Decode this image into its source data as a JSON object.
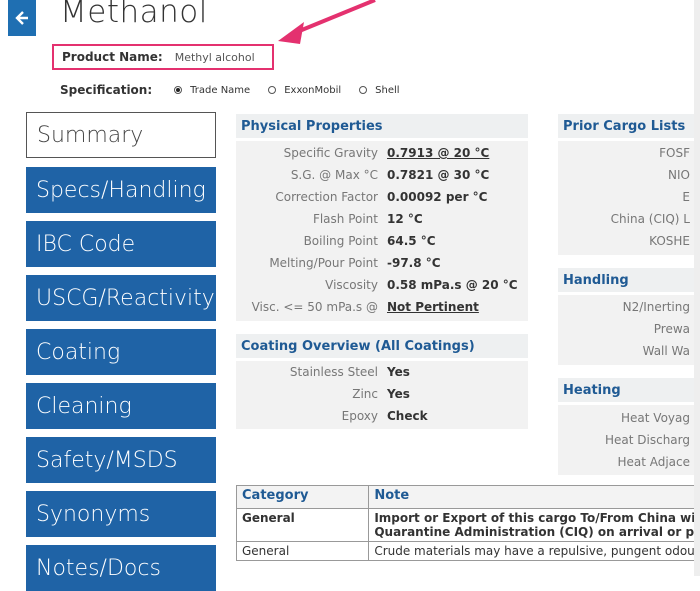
{
  "header": {
    "title": "Methanol"
  },
  "product": {
    "label": "Product Name:",
    "value": "Methyl alcohol"
  },
  "specification": {
    "label": "Specification:",
    "options": [
      {
        "label": "Trade Name",
        "selected": true
      },
      {
        "label": "ExxonMobil",
        "selected": false
      },
      {
        "label": "Shell",
        "selected": false
      }
    ]
  },
  "nav": [
    {
      "label": "Summary",
      "active": true
    },
    {
      "label": "Specs/Handling",
      "active": false
    },
    {
      "label": "IBC Code",
      "active": false
    },
    {
      "label": "USCG/Reactivity",
      "active": false
    },
    {
      "label": "Coating",
      "active": false
    },
    {
      "label": "Cleaning",
      "active": false
    },
    {
      "label": "Safety/MSDS",
      "active": false
    },
    {
      "label": "Synonyms",
      "active": false
    },
    {
      "label": "Notes/Docs",
      "active": false
    }
  ],
  "physical": {
    "title": "Physical Properties",
    "rows": [
      {
        "key": "Specific Gravity",
        "value": "0.7913 @ 20 °C",
        "link": true
      },
      {
        "key": "S.G. @ Max °C",
        "value": "0.7821 @ 30 °C",
        "link": false
      },
      {
        "key": "Correction Factor",
        "value": "0.00092 per °C",
        "link": false
      },
      {
        "key": "Flash Point",
        "value": "12 °C",
        "link": false
      },
      {
        "key": "Boiling Point",
        "value": "64.5 °C",
        "link": false
      },
      {
        "key": "Melting/Pour Point",
        "value": "-97.8 °C",
        "link": false
      },
      {
        "key": "Viscosity",
        "value": "0.58 mPa.s @ 20 °C",
        "link": false
      },
      {
        "key": "Visc. <= 50 mPa.s @",
        "value": "Not Pertinent",
        "link": true
      }
    ]
  },
  "coating": {
    "title": "Coating Overview (All Coatings)",
    "rows": [
      {
        "key": "Stainless Steel",
        "value": "Yes"
      },
      {
        "key": "Zinc",
        "value": "Yes"
      },
      {
        "key": "Epoxy",
        "value": "Check"
      }
    ]
  },
  "prior_cargo": {
    "title": "Prior Cargo Lists",
    "rows": [
      "FOSF",
      "NIO",
      "E",
      "China (CIQ) L",
      "KOSHE"
    ]
  },
  "handling": {
    "title": "Handling",
    "rows": [
      "N2/Inerting",
      "Prewa",
      "Wall Wa"
    ]
  },
  "heating": {
    "title": "Heating",
    "rows": [
      "Heat Voyag",
      "Heat Discharg",
      "Heat Adjace"
    ]
  },
  "notes_table": {
    "headers": [
      "Category",
      "Note"
    ],
    "rows": [
      {
        "category": "General",
        "note_line1": "Import or Export of this cargo To/From China wi",
        "note_line2": "Quarantine Administration (CIQ) on arrival or pr",
        "bold": true
      },
      {
        "category": "General",
        "note_line1": "Crude materials may have a repulsive, pungent odou",
        "note_line2": "",
        "bold": false
      }
    ]
  },
  "colors": {
    "nav_blue": "#1f63a6",
    "header_blue": "#1f5a94",
    "highlight_pink": "#e4316f"
  }
}
